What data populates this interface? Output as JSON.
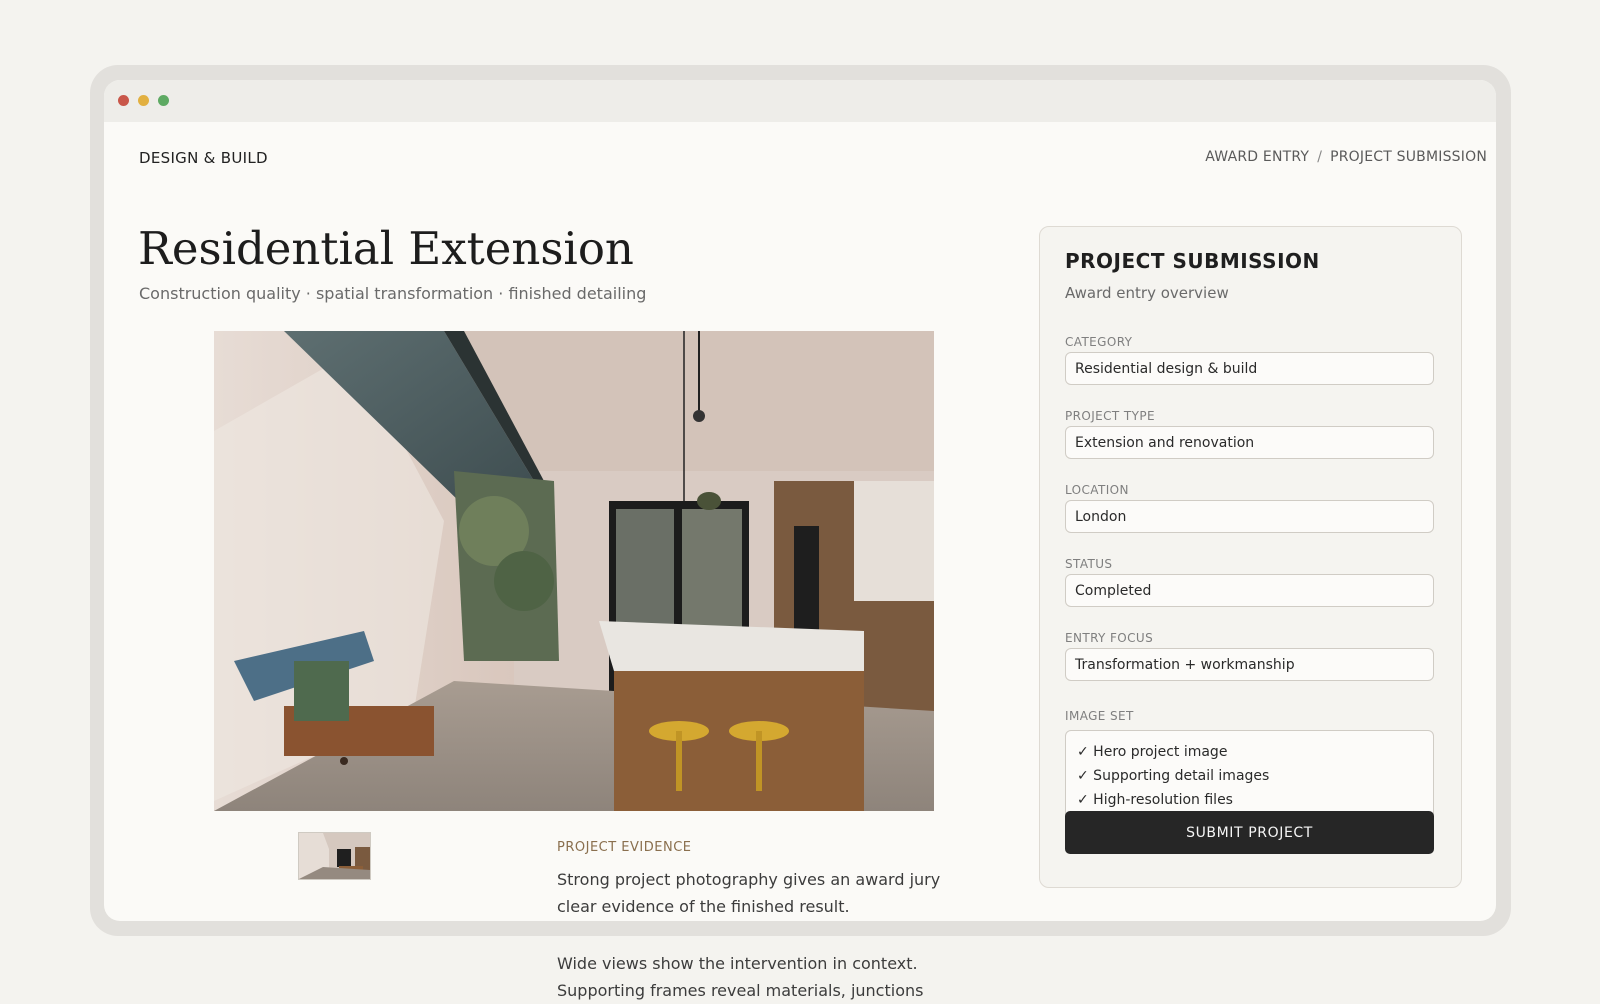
{
  "header": {
    "brand": "DESIGN & BUILD",
    "breadcrumb": [
      "AWARD ENTRY",
      "PROJECT SUBMISSION"
    ],
    "breadcrumb_separator": "/"
  },
  "main": {
    "title": "Residential Extension",
    "subtitle": "Construction quality · spatial transformation · finished detailing",
    "hero_image": "kitchen-extension-photo",
    "evidence": {
      "label": "PROJECT EVIDENCE",
      "paragraph1": "Strong project photography gives an award jury clear evidence of the finished result.",
      "paragraph2": "Wide views show the intervention in context. Supporting frames reveal materials, junctions"
    }
  },
  "panel": {
    "title": "PROJECT SUBMISSION",
    "subtitle": "Award entry overview",
    "fields": [
      {
        "label": "CATEGORY",
        "value": "Residential design & build"
      },
      {
        "label": "PROJECT TYPE",
        "value": "Extension and renovation"
      },
      {
        "label": "LOCATION",
        "value": "London"
      },
      {
        "label": "STATUS",
        "value": "Completed"
      },
      {
        "label": "ENTRY FOCUS",
        "value": "Transformation + workmanship"
      }
    ],
    "image_set": {
      "label": "IMAGE SET",
      "items": [
        "✓ Hero project image",
        "✓ Supporting detail images",
        "✓ High-resolution files"
      ]
    },
    "submit_label": "SUBMIT PROJECT"
  },
  "colors": {
    "accent_label": "#8a6f4e",
    "button_bg": "#262626",
    "window_dot_red": "#c9574a",
    "window_dot_yellow": "#e2b040",
    "window_dot_green": "#5eaa63"
  }
}
